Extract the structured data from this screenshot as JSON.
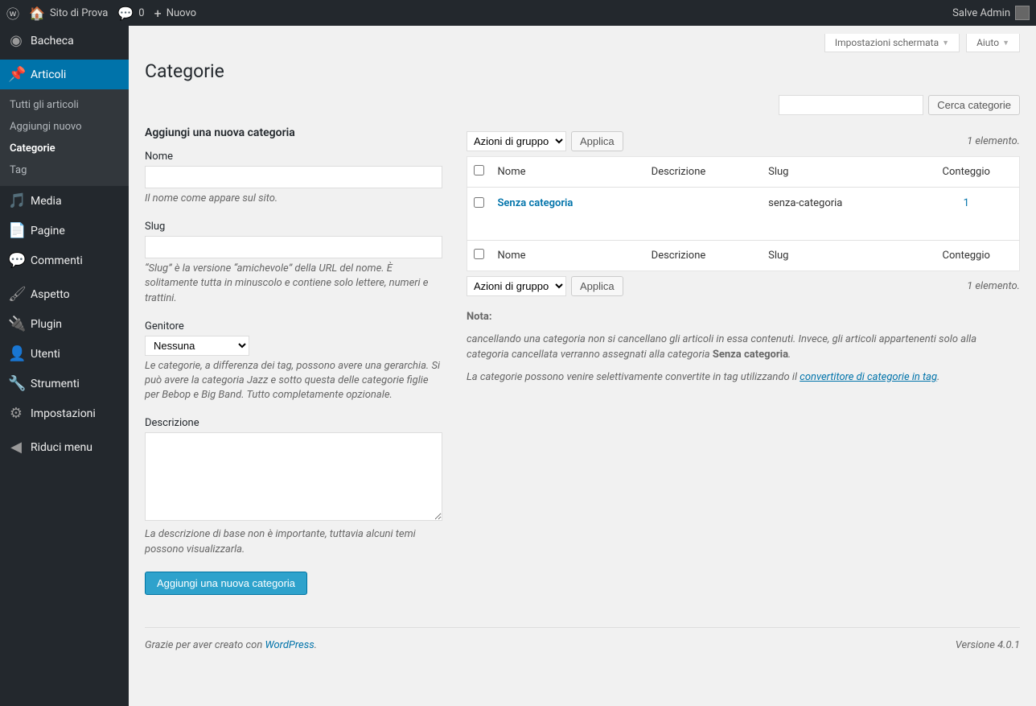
{
  "toolbar": {
    "site_name": "Sito di Prova",
    "comments_count": "0",
    "new_label": "Nuovo",
    "greeting": "Salve Admin"
  },
  "sidebar": {
    "items": [
      {
        "label": "Bacheca",
        "icon": "dashboard"
      },
      {
        "label": "Articoli",
        "icon": "pin",
        "current": true
      },
      {
        "label": "Media",
        "icon": "media"
      },
      {
        "label": "Pagine",
        "icon": "page"
      },
      {
        "label": "Commenti",
        "icon": "comment"
      },
      {
        "label": "Aspetto",
        "icon": "brush"
      },
      {
        "label": "Plugin",
        "icon": "plug"
      },
      {
        "label": "Utenti",
        "icon": "user"
      },
      {
        "label": "Strumenti",
        "icon": "wrench"
      },
      {
        "label": "Impostazioni",
        "icon": "sliders"
      }
    ],
    "submenu": [
      "Tutti gli articoli",
      "Aggiungi nuovo",
      "Categorie",
      "Tag"
    ],
    "collapse_label": "Riduci menu"
  },
  "screen_tabs": {
    "options": "Impostazioni schermata",
    "help": "Aiuto"
  },
  "page": {
    "title": "Categorie",
    "search_button": "Cerca categorie"
  },
  "form": {
    "heading": "Aggiungi una nuova categoria",
    "name_label": "Nome",
    "name_help": "Il nome come appare sul sito.",
    "slug_label": "Slug",
    "slug_help": "“Slug” è la versione “amichevole” della URL del nome. È solitamente tutta in minuscolo e contiene solo lettere, numeri e trattini.",
    "parent_label": "Genitore",
    "parent_option": "Nessuna",
    "parent_help": "Le categorie, a differenza dei tag, possono avere una gerarchia. Si può avere la categoria Jazz e sotto questa delle categorie figlie per Bebop e Big Band. Tutto completamente opzionale.",
    "desc_label": "Descrizione",
    "desc_help": "La descrizione di base non è importante, tuttavia alcuni temi possono visualizzarla.",
    "submit": "Aggiungi una nuova categoria"
  },
  "table": {
    "bulk_action": "Azioni di gruppo",
    "apply": "Applica",
    "count_text": "1 elemento.",
    "cols": {
      "name": "Nome",
      "desc": "Descrizione",
      "slug": "Slug",
      "count": "Conteggio"
    },
    "rows": [
      {
        "name": "Senza categoria",
        "desc": "",
        "slug": "senza-categoria",
        "count": "1"
      }
    ]
  },
  "notes": {
    "heading": "Nota:",
    "p1a": "cancellando una categoria non si cancellano gli articoli in essa contenuti. Invece, gli articoli appartenenti solo alla categoria cancellata verranno assegnati alla categoria ",
    "p1b": "Senza categoria",
    "p2a": "La categorie possono venire selettivamente convertite in tag utilizzando il ",
    "p2link": "convertitore di categorie in tag"
  },
  "footer": {
    "thanks_pre": "Grazie per aver creato con ",
    "wp": "WordPress",
    "version": "Versione 4.0.1"
  }
}
